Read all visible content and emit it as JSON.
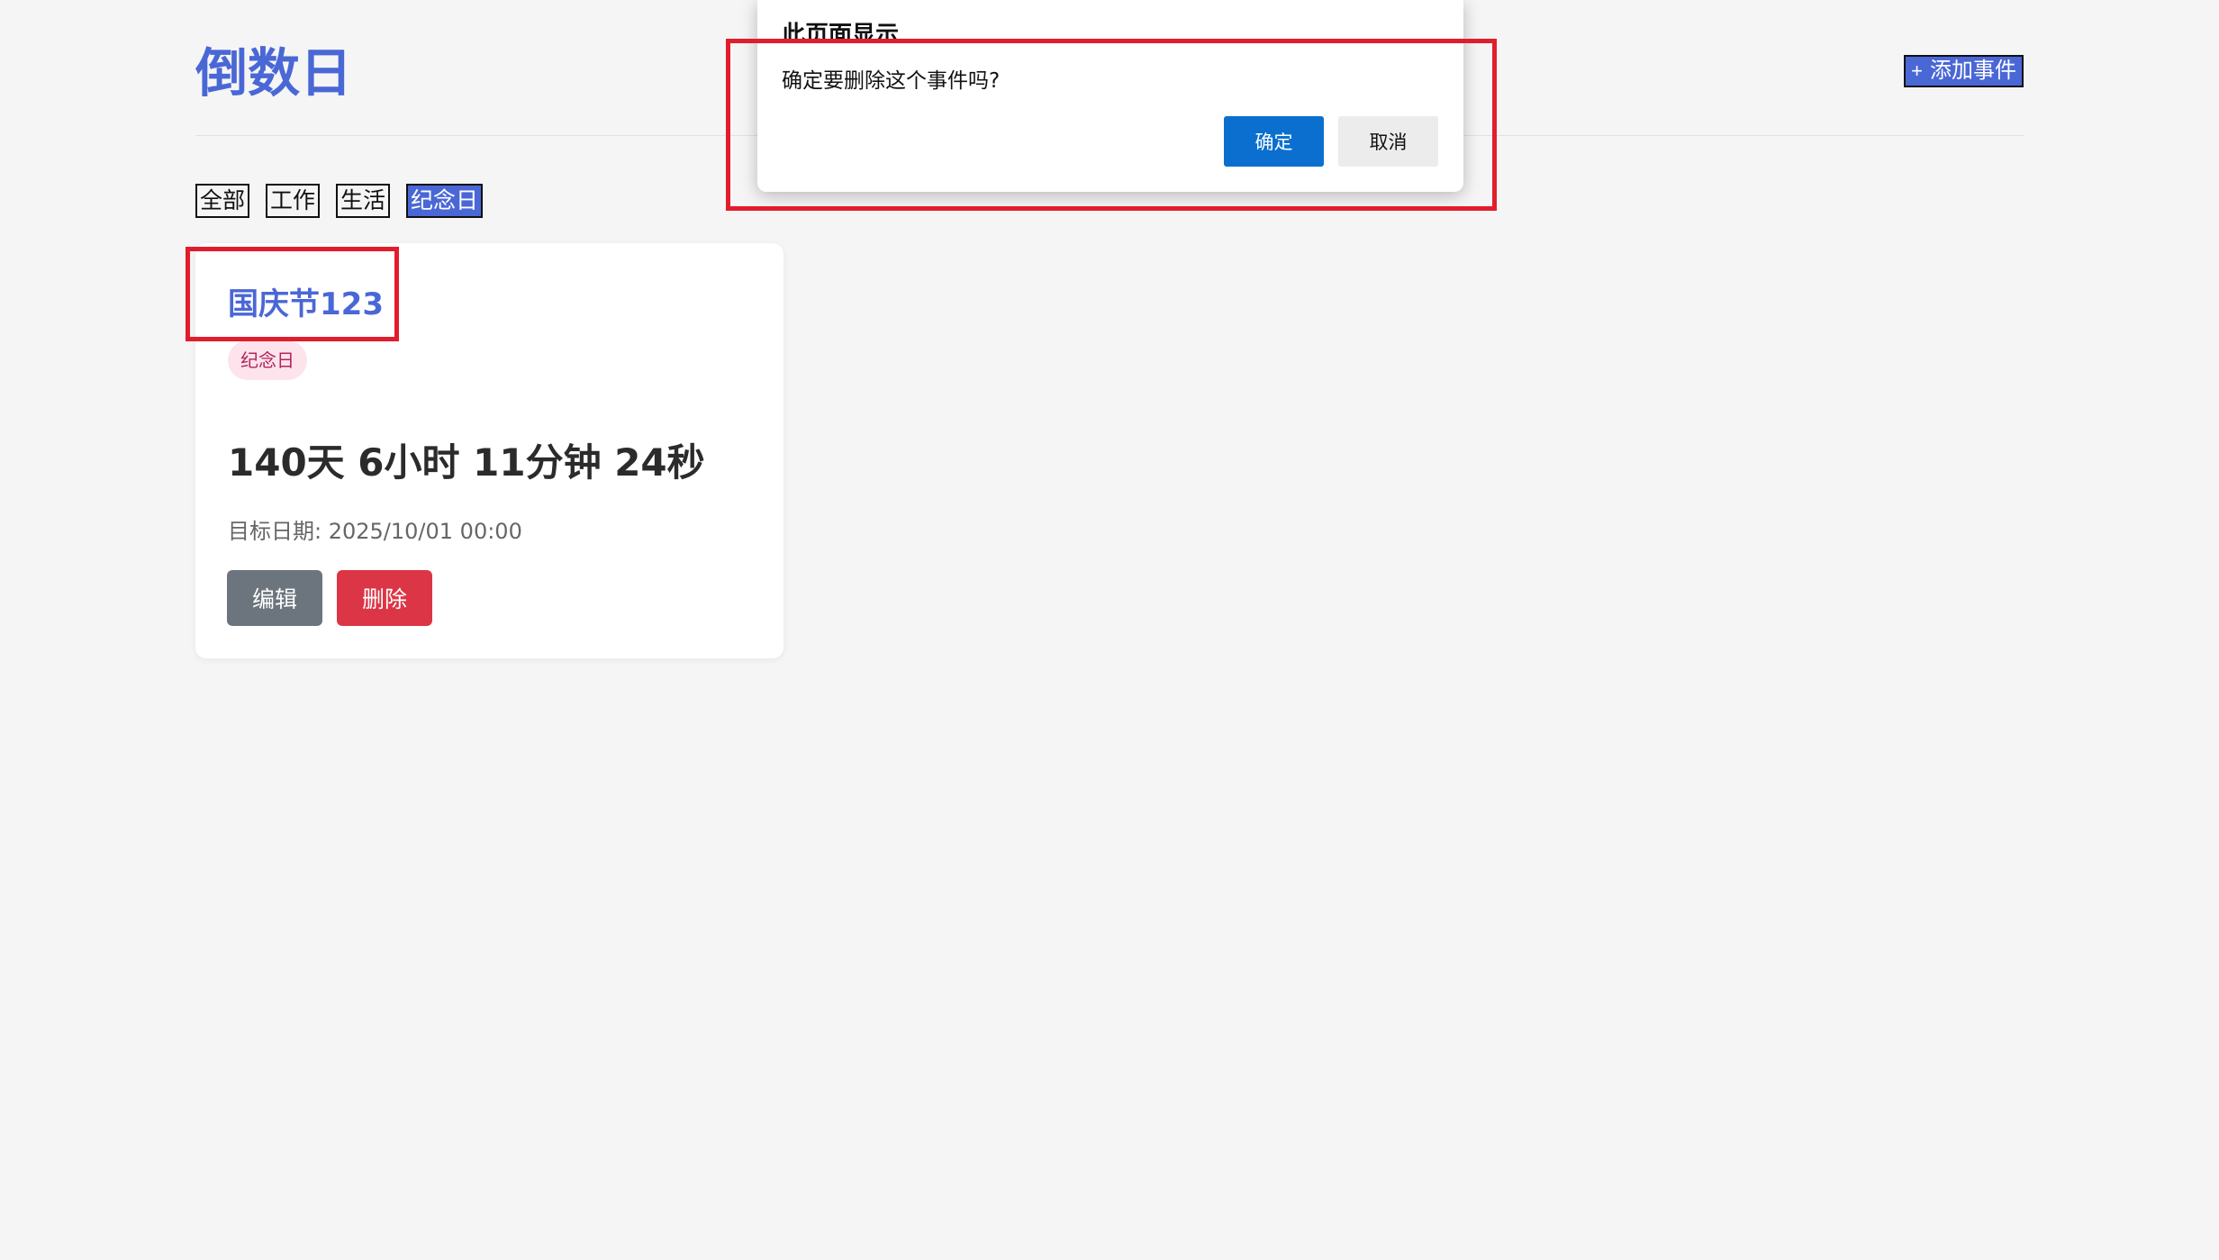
{
  "app": {
    "title": "倒数日",
    "add_button_icon": "+",
    "add_button_label": "添加事件",
    "accent_color": "#4a67d6"
  },
  "filters": [
    {
      "label": "全部",
      "active": false
    },
    {
      "label": "工作",
      "active": false
    },
    {
      "label": "生活",
      "active": false
    },
    {
      "label": "纪念日",
      "active": true
    }
  ],
  "event_card": {
    "title": "国庆节123",
    "tag": "纪念日",
    "countdown": "140天 6小时 11分钟 24秒",
    "target_date": "目标日期: 2025/10/01 00:00",
    "edit_label": "编辑",
    "delete_label": "删除"
  },
  "dialog": {
    "title": "此页面显示",
    "message": "确定要删除这个事件吗?",
    "ok_label": "确定",
    "cancel_label": "取消",
    "ok_color": "#0b6fd0"
  },
  "annotation_color": "#e21d2b"
}
